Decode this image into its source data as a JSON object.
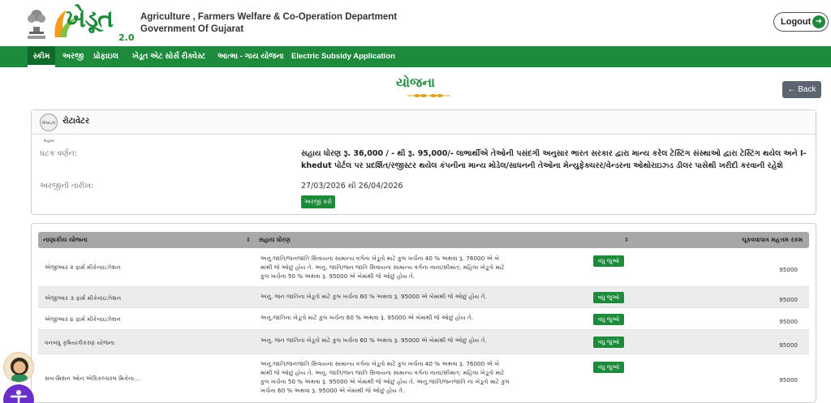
{
  "header": {
    "logo_text": "ખેડૂત",
    "logo_version": "2.0",
    "dept_line1": "Agriculture , Farmers Welfare & Co-Operation Department",
    "dept_line2": "Government Of Gujarat",
    "logout_label": "Logout"
  },
  "nav": {
    "items": [
      "સ્કીમ",
      "અરજી",
      "પ્રોફાઇલ",
      "ખેડૂત એટ સોર્સ રીક્વેસ્ટ",
      "આત્મા - ગાય યોજના",
      "Electric Subsidy Application"
    ],
    "active_index": 0
  },
  "page": {
    "title": "યોજના",
    "back_label": "← Back"
  },
  "scheme": {
    "name": "રોટાવેટર",
    "badge_text": "મોબાઇલ સહાય",
    "component_label": "ઘટક વર્ણન:",
    "description": "સહાય ધોરણ રૂ. 36,000 / - થી રૂ. 95,000/- લાભાર્થીએ તેઓની પસંદગી અનુસાર ભારત સરકાર દ્વારા માન્ય કરેલ ટેસ્ટિંગ સંસ્થાઓ દ્વારા ટેસ્ટિંગ થયેલ અને I-khedut પોર્ટલ પર પ્રદર્શિત/રજીસ્ટર થયેલ કંપનીના માન્ય મોડેલ/સાધનની તેઓના મેન્યુફેક્ચરર/વેન્ડરના ઓથોરાઇઝ્ડ ડીલર પાસેથી ખરીદી કરવાની રહેશે",
    "date_label": "અરજીની તારીખ:",
    "dates": "27/03/2026 થી 26/04/2026",
    "apply_label": "અરજી કરો"
  },
  "table": {
    "headers": [
      "નાણાકીય યોજના",
      "સહાય ધોરણ",
      "ચૂકવવાપાત્ર મહત્તમ રકમ"
    ],
    "more_label": "વધુ જુઓ",
    "rows": [
      {
        "name": "એજીઆર ૨ ફાર્મ મીકેનાઇઝેશન",
        "lines": [
          "અનુ.જાતિ/જનજાતિ સિવાયના સામાન્ય વર્ગના ખેડૂતો માટે કુલ ખર્ચના 40 % અથવા રૂ. 76000 એ બે",
          "માંથી જે ઓછું હોય તે. અનુ. જાતિ/જન જાતિ સિવાયના સામાન્ય વર્ગના નાના/સીમાંત; મહિલા ખેડૂતો માટે",
          "કુલ ખર્ચના 50 % અથવા રૂ. 95000 એ બેમાંથી જે ઓછું હોય તે."
        ],
        "amount": "95000"
      },
      {
        "name": "એજીઆર ૩ ફાર્મ મીકેનાઇઝેશન",
        "lines": [
          "અનુ. જન જાતિના ખેડૂતો માટે કુલ ખર્ચના 60 % અથવા રૂ. 95000 એ બેમાંથી જે ઓછું હોય તે."
        ],
        "amount": "95000"
      },
      {
        "name": "એજીઆર ૪ ફાર્મ મીકેનાઇઝેશન",
        "lines": [
          "અનુ.જાતિના ખેડૂતો માટે કુલ ખર્ચના 60 % અથવા રૂ. 95000 એ બેમાંથી જે ઓછું હોય તે."
        ],
        "amount": "95000"
      },
      {
        "name": "વનબંધુ કૃષિયાંત્રીકરણ યોજના",
        "lines": [
          "અનુ. જન જાતિના ખેડૂતો માટે કુલ ખર્ચના 60 % અથવા રૂ. 95000 એ બેમાંથી જે ઓછું હોય તે."
        ],
        "amount": "95000"
      },
      {
        "name": "સબ-મિશન ઓન એગ્રિકલ્ચરલ મિકેના...",
        "lines": [
          "અનુ.જાતિ/જનજાતિ સિવાયના સામાન્ય વર્ગના ખેડૂતો માટે કુલ ખર્ચના 40 % અથવા રૂ. 76000 એ બે",
          "માંથી જે ઓછું હોય તે. અનુ. જાતિ/જન જાતિ સિવાયના સામાન્ય વર્ગના નાના/સીમાંત; મહિલા ખેડૂતો માટે",
          "કુલ ખર્ચના 50 % અથવા રૂ. 95000 એ બેમાંથી જે ઓછું હોય તે. અનુ.જાતિ/જનજાતિ ના ખેડૂતો માટે કુલ",
          "ખર્ચના 60 % અથવા રૂ. 95000 એ બેમાંથી જે ઓછું હોય તે."
        ],
        "amount": "95000"
      }
    ]
  },
  "colors": {
    "brand_green": "#1e8a3c",
    "nav_active": "#0f6a2a",
    "table_header": "#a7a7a7",
    "back_button": "#5d6470",
    "accessibility": "#6a2fc9"
  }
}
